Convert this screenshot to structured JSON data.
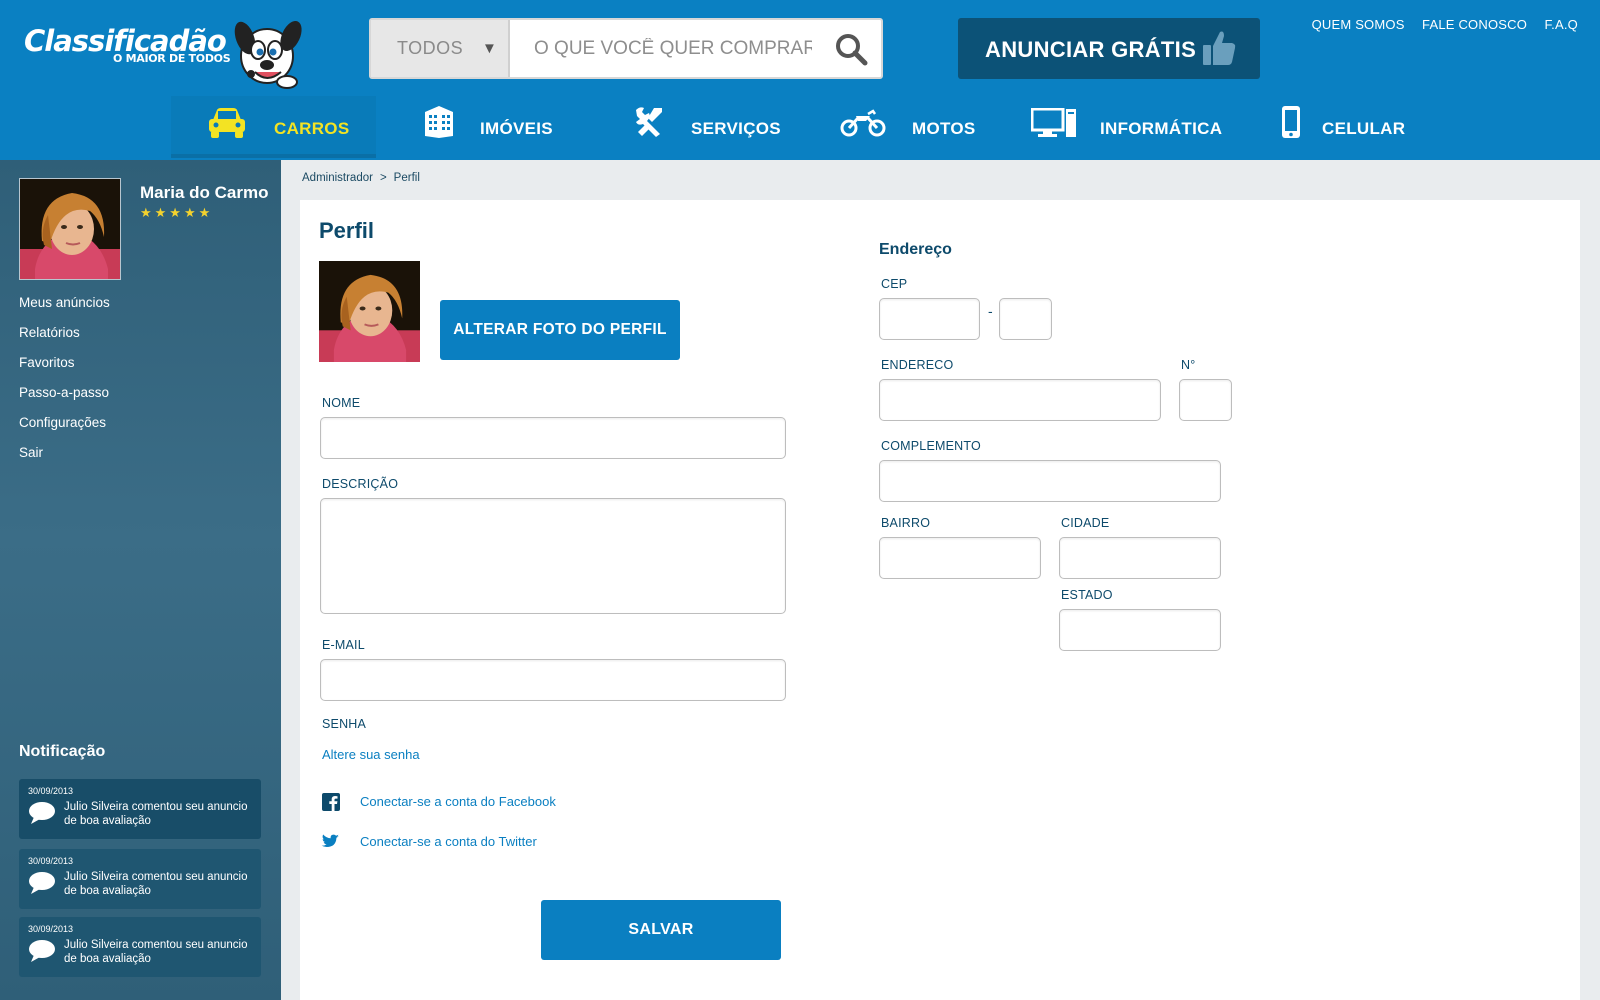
{
  "brand": {
    "name": "Classificadão",
    "tagline": "O MAIOR DE TODOS"
  },
  "search": {
    "category": "TODOS",
    "placeholder": "O QUE VOCÊ QUER COMPRAR?",
    "value": ""
  },
  "announce": {
    "label": "ANUNCIAR GRÁTIS"
  },
  "toplinks": [
    "QUEM SOMOS",
    "FALE CONOSCO",
    "F.A.Q"
  ],
  "nav": [
    {
      "label": "CARROS",
      "icon": "car-icon",
      "active": true
    },
    {
      "label": "IMÓVEIS",
      "icon": "building-icon",
      "active": false
    },
    {
      "label": "SERVIÇOS",
      "icon": "tools-icon",
      "active": false
    },
    {
      "label": "MOTOS",
      "icon": "motorcycle-icon",
      "active": false
    },
    {
      "label": "INFORMÁTICA",
      "icon": "computer-icon",
      "active": false
    },
    {
      "label": "CELULAR",
      "icon": "phone-icon",
      "active": false
    }
  ],
  "user": {
    "name": "Maria do Carmo",
    "stars": "★★★★★",
    "rating": 5
  },
  "sidebar_menu": [
    "Meus anúncios",
    "Relatórios",
    "Favoritos",
    "Passo-a-passo",
    "Configurações",
    "Sair"
  ],
  "notifications": {
    "title": "Notificação",
    "items": [
      {
        "date": "30/09/2013",
        "text": "Julio Silveira comentou seu anuncio de boa avaliação"
      },
      {
        "date": "30/09/2013",
        "text": "Julio Silveira comentou seu anuncio de boa avaliação"
      },
      {
        "date": "30/09/2013",
        "text": "Julio Silveira comentou seu anuncio de boa avaliação"
      }
    ]
  },
  "breadcrumb": [
    "Administrador",
    ">",
    "Perfil"
  ],
  "profile": {
    "title": "Perfil",
    "change_photo": "ALTERAR FOTO DO PERFIL",
    "name_label": "NOME",
    "name_value": "",
    "description_label": "DESCRIÇÃO",
    "description_value": "",
    "email_label": "E-MAIL",
    "email_value": "",
    "password_label": "SENHA",
    "password_link": "Altere sua senha",
    "facebook_link": "Conectar-se a conta do Facebook",
    "twitter_link": "Conectar-se a conta do Twitter",
    "save": "SALVAR"
  },
  "address": {
    "title": "Endereço",
    "cep_label": "CEP",
    "cep_dash": "-",
    "street_label": "ENDERECO",
    "number_label": "N°",
    "complement_label": "COMPLEMENTO",
    "district_label": "BAIRRO",
    "city_label": "CIDADE",
    "state_label": "ESTADO"
  },
  "colors": {
    "header_blue": "#0a80c2",
    "dark_blue": "#0c5277",
    "sidebar": "#2f5f78",
    "button_blue": "#0a7fc1",
    "active_yellow": "#f3e323",
    "star_yellow": "#f4d22e"
  }
}
